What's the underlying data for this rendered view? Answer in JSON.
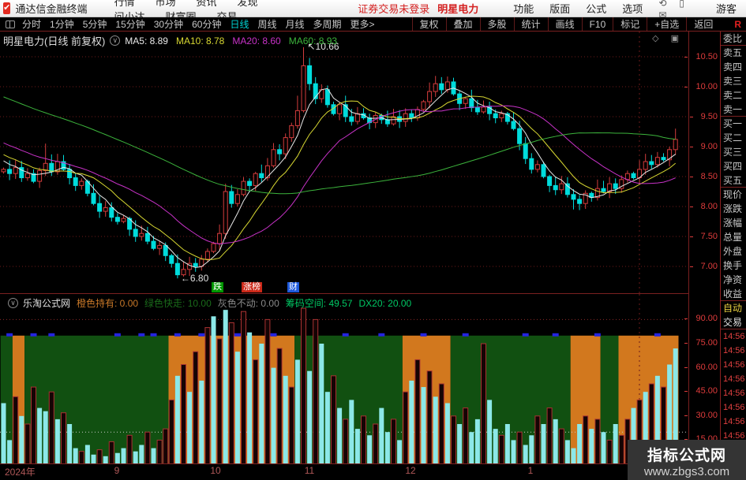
{
  "menu_bar": {
    "logo_glyph": "✔",
    "brand": "通达信金融终端",
    "items": [
      "行情",
      "市场",
      "资讯",
      "发现",
      "问小达",
      "财富圈",
      "交易"
    ],
    "login_status": "证券交易未登录",
    "stock_name": "明星电力",
    "right_items": [
      "功能",
      "版面",
      "公式",
      "选项"
    ],
    "icons": [
      {
        "name": "feedback-icon",
        "glyph": "⟲"
      },
      {
        "name": "phone-icon",
        "glyph": "▯"
      },
      {
        "name": "mail-icon",
        "glyph": "✉"
      }
    ],
    "user": "游客"
  },
  "period_bar": {
    "items": [
      "分时",
      "1分钟",
      "5分钟",
      "15分钟",
      "30分钟",
      "60分钟",
      "日线",
      "周线",
      "月线",
      "多周期",
      "更多>"
    ],
    "active": "日线",
    "right_items": [
      "复权",
      "叠加",
      "多股",
      "统计",
      "画线",
      "F10",
      "标记",
      "+自选",
      "返回"
    ],
    "r_label": "R"
  },
  "main_chart": {
    "title": "明星电力(日线 前复权)",
    "dropdown_glyph": "∨",
    "ma_labels": [
      {
        "label": "MA5:",
        "value": "8.89",
        "color": "#e8e8e8"
      },
      {
        "label": "MA10:",
        "value": "8.78",
        "color": "#d8d832"
      },
      {
        "label": "MA20:",
        "value": "8.60",
        "color": "#c832c8"
      },
      {
        "label": "MA60:",
        "value": "8.93",
        "color": "#3cb43c"
      }
    ],
    "corner_icons": "◇ ▣",
    "high_label": "↖10.66",
    "low_label": "←6.80",
    "event_tags": [
      {
        "text": "跌",
        "bg": "#009600",
        "x": 268
      },
      {
        "text": "涨榜",
        "bg": "#cc2818",
        "x": 306
      },
      {
        "text": "财",
        "bg": "#1e5adc",
        "x": 364
      }
    ],
    "y_ticks": [
      {
        "v": 10.5,
        "label": "10.50"
      },
      {
        "v": 10.0,
        "label": "10.00"
      },
      {
        "v": 9.5,
        "label": "9.50"
      },
      {
        "v": 9.0,
        "label": "9.00"
      },
      {
        "v": 8.5,
        "label": "8.50"
      },
      {
        "v": 8.0,
        "label": "8.00"
      },
      {
        "v": 7.5,
        "label": "7.50"
      },
      {
        "v": 7.0,
        "label": "7.00"
      }
    ]
  },
  "indicator_panel": {
    "source": "乐淘公式网",
    "dropdown_glyph": "∨",
    "params": [
      {
        "label": "橙色持有:",
        "value": "0.00",
        "color": "#c87828"
      },
      {
        "label": "绿色快走:",
        "value": "10.00",
        "color": "#1a6b1a"
      },
      {
        "label": "灰色不动:",
        "value": "0.00",
        "color": "#8a8a8a"
      },
      {
        "label": "筹码空间:",
        "value": "49.57",
        "color": "#00c864"
      },
      {
        "label": "DX20:",
        "value": "20.00",
        "color": "#00c864"
      }
    ],
    "y_ticks": [
      {
        "v": 90,
        "label": "90.00"
      },
      {
        "v": 75,
        "label": "75.00"
      },
      {
        "v": 60,
        "label": "60.00"
      },
      {
        "v": 45,
        "label": "45.00"
      },
      {
        "v": 30,
        "label": "30.00"
      },
      {
        "v": 15,
        "label": "15.00"
      }
    ]
  },
  "sidebar": {
    "quote_rows": [
      "委比",
      "卖五",
      "卖四",
      "卖三",
      "卖二",
      "卖一",
      "买一",
      "买二",
      "买三",
      "买四",
      "买五"
    ],
    "info_rows": [
      "现价",
      "涨跌",
      "涨幅",
      "总量",
      "外盘",
      "换手",
      "净资",
      "收益"
    ],
    "trade_rows": [
      {
        "text": "自动",
        "color": "#e8d040"
      },
      {
        "text": "交易",
        "color": "#e0e0e0"
      }
    ],
    "tick_times": [
      "14:56",
      "14:56",
      "14:56",
      "14:56",
      "14:56",
      "14:56",
      "14:56",
      "14:56",
      "14:56"
    ]
  },
  "date_axis": {
    "labels": [
      {
        "text": "2024年",
        "x": 6,
        "center": false
      },
      {
        "text": "9",
        "x": 148,
        "center": true
      },
      {
        "text": "10",
        "x": 273,
        "center": true
      },
      {
        "text": "11",
        "x": 392,
        "center": true
      },
      {
        "text": "12",
        "x": 520,
        "center": true
      },
      {
        "text": "1",
        "x": 672,
        "center": true
      }
    ]
  },
  "watermark": {
    "line1": "指标公式网",
    "line2": "www.zbgs3.com"
  },
  "chart_data": {
    "type": "candlestick",
    "main": {
      "title": "明星电力 日线 前复权",
      "ylim": [
        6.71,
        10.92
      ],
      "gridlines": [
        10.5,
        10.0,
        9.5,
        9.0,
        8.5,
        8.0,
        7.5,
        7.0
      ],
      "high_marker": {
        "index": 50,
        "value": 10.66
      },
      "low_marker": {
        "index": 29,
        "value": 6.8
      },
      "first_open": 8.58,
      "closes": [
        8.62,
        8.55,
        8.65,
        8.48,
        8.55,
        8.42,
        8.6,
        8.72,
        8.58,
        8.75,
        8.62,
        8.48,
        8.35,
        8.42,
        8.22,
        8.05,
        7.92,
        7.98,
        7.82,
        7.75,
        7.8,
        7.62,
        7.5,
        7.55,
        7.42,
        7.3,
        7.35,
        7.18,
        7.05,
        6.86,
        6.95,
        7.05,
        7.0,
        7.12,
        7.25,
        7.38,
        7.55,
        8.25,
        8.05,
        8.2,
        8.42,
        8.35,
        8.55,
        8.48,
        8.68,
        8.95,
        8.88,
        9.15,
        9.35,
        9.6,
        10.35,
        10.05,
        9.8,
        9.95,
        9.7,
        9.55,
        9.7,
        9.5,
        9.42,
        9.55,
        9.48,
        9.4,
        9.52,
        9.45,
        9.38,
        9.5,
        9.42,
        9.55,
        9.48,
        9.62,
        9.75,
        9.92,
        10.05,
        9.95,
        10.08,
        9.88,
        9.72,
        9.8,
        9.65,
        9.58,
        9.66,
        9.55,
        9.48,
        9.55,
        9.42,
        9.3,
        9.05,
        8.8,
        8.62,
        8.7,
        8.5,
        8.35,
        8.28,
        8.38,
        8.2,
        8.12,
        8.05,
        8.22,
        8.15,
        8.3,
        8.25,
        8.38,
        8.3,
        8.45,
        8.55,
        8.48,
        8.62,
        8.75,
        8.7,
        8.82,
        8.78,
        8.95,
        9.12
      ],
      "specials": {
        "7": {
          "h": 9.05
        },
        "29": {
          "l": 6.8
        },
        "49": {
          "h": 9.85
        },
        "50": {
          "h": 10.66
        },
        "95": {
          "l": 7.95
        },
        "112": {
          "h": 9.3
        }
      },
      "ma_lines": [
        {
          "period": 5,
          "color": "#e8e8e8"
        },
        {
          "period": 10,
          "color": "#d8d832"
        },
        {
          "period": 20,
          "color": "#c832c8"
        },
        {
          "period": 60,
          "color": "#3cb43c"
        }
      ],
      "ma_prehistory": {
        "start": 11.0,
        "end": 8.74,
        "n": 60
      },
      "vline_x": 810
    },
    "indicator": {
      "ylim": [
        0,
        100
      ],
      "ref_lines": [
        {
          "v": 90,
          "color": "#8b2a2a"
        },
        {
          "v": 20,
          "color": "#c8c8c8"
        }
      ],
      "bg_top_value": 80,
      "bg_colors": {
        "g": "#115011",
        "o": "#d2781e"
      },
      "bg_segments": [
        [
          0,
          1,
          "g"
        ],
        [
          2,
          3,
          "o"
        ],
        [
          4,
          27,
          "g"
        ],
        [
          28,
          48,
          "o"
        ],
        [
          49,
          66,
          "g"
        ],
        [
          67,
          74,
          "o"
        ],
        [
          75,
          94,
          "g"
        ],
        [
          95,
          99,
          "o"
        ],
        [
          100,
          102,
          "g"
        ],
        [
          103,
          112,
          "o"
        ]
      ],
      "blue_marks": [
        1,
        5,
        8,
        19,
        23,
        25,
        29,
        33,
        39,
        45,
        57,
        63,
        70,
        77,
        87,
        92,
        99,
        109
      ],
      "bars": [
        [
          38,
          0
        ],
        [
          15,
          0
        ],
        [
          42,
          1
        ],
        [
          30,
          0
        ],
        [
          25,
          1
        ],
        [
          48,
          1
        ],
        [
          35,
          0
        ],
        [
          33,
          0
        ],
        [
          45,
          1
        ],
        [
          28,
          0
        ],
        [
          32,
          1
        ],
        [
          25,
          0
        ],
        [
          10,
          0
        ],
        [
          8,
          1
        ],
        [
          12,
          0
        ],
        [
          6,
          0
        ],
        [
          9,
          1
        ],
        [
          5,
          0
        ],
        [
          14,
          1
        ],
        [
          7,
          0
        ],
        [
          10,
          0
        ],
        [
          18,
          1
        ],
        [
          8,
          0
        ],
        [
          12,
          0
        ],
        [
          20,
          1
        ],
        [
          10,
          0
        ],
        [
          15,
          1
        ],
        [
          22,
          1
        ],
        [
          40,
          1
        ],
        [
          55,
          0
        ],
        [
          62,
          1
        ],
        [
          45,
          0
        ],
        [
          70,
          1
        ],
        [
          52,
          0
        ],
        [
          85,
          1
        ],
        [
          92,
          0
        ],
        [
          78,
          1
        ],
        [
          96,
          0
        ],
        [
          88,
          1
        ],
        [
          70,
          0
        ],
        [
          95,
          1
        ],
        [
          82,
          0
        ],
        [
          65,
          1
        ],
        [
          75,
          0
        ],
        [
          90,
          1
        ],
        [
          60,
          0
        ],
        [
          72,
          1
        ],
        [
          55,
          0
        ],
        [
          48,
          1
        ],
        [
          65,
          0
        ],
        [
          97,
          1
        ],
        [
          58,
          0
        ],
        [
          90,
          1
        ],
        [
          75,
          0
        ],
        [
          45,
          0
        ],
        [
          55,
          1
        ],
        [
          35,
          0
        ],
        [
          28,
          1
        ],
        [
          40,
          0
        ],
        [
          22,
          0
        ],
        [
          30,
          1
        ],
        [
          18,
          0
        ],
        [
          25,
          1
        ],
        [
          35,
          0
        ],
        [
          20,
          0
        ],
        [
          28,
          1
        ],
        [
          15,
          0
        ],
        [
          45,
          1
        ],
        [
          52,
          0
        ],
        [
          65,
          1
        ],
        [
          48,
          0
        ],
        [
          58,
          1
        ],
        [
          42,
          0
        ],
        [
          50,
          1
        ],
        [
          38,
          0
        ],
        [
          30,
          1
        ],
        [
          25,
          0
        ],
        [
          35,
          1
        ],
        [
          20,
          0
        ],
        [
          28,
          0
        ],
        [
          75,
          1
        ],
        [
          40,
          0
        ],
        [
          22,
          0
        ],
        [
          18,
          1
        ],
        [
          25,
          0
        ],
        [
          15,
          0
        ],
        [
          20,
          1
        ],
        [
          12,
          0
        ],
        [
          18,
          0
        ],
        [
          30,
          1
        ],
        [
          25,
          0
        ],
        [
          35,
          1
        ],
        [
          28,
          0
        ],
        [
          22,
          1
        ],
        [
          15,
          0
        ],
        [
          10,
          0
        ],
        [
          25,
          0
        ],
        [
          30,
          1
        ],
        [
          22,
          0
        ],
        [
          28,
          1
        ],
        [
          20,
          0
        ],
        [
          15,
          1
        ],
        [
          25,
          0
        ],
        [
          18,
          1
        ],
        [
          28,
          1
        ],
        [
          35,
          0
        ],
        [
          40,
          1
        ],
        [
          45,
          0
        ],
        [
          50,
          1
        ],
        [
          55,
          0
        ],
        [
          48,
          1
        ],
        [
          62,
          0
        ],
        [
          72,
          0
        ]
      ]
    }
  }
}
